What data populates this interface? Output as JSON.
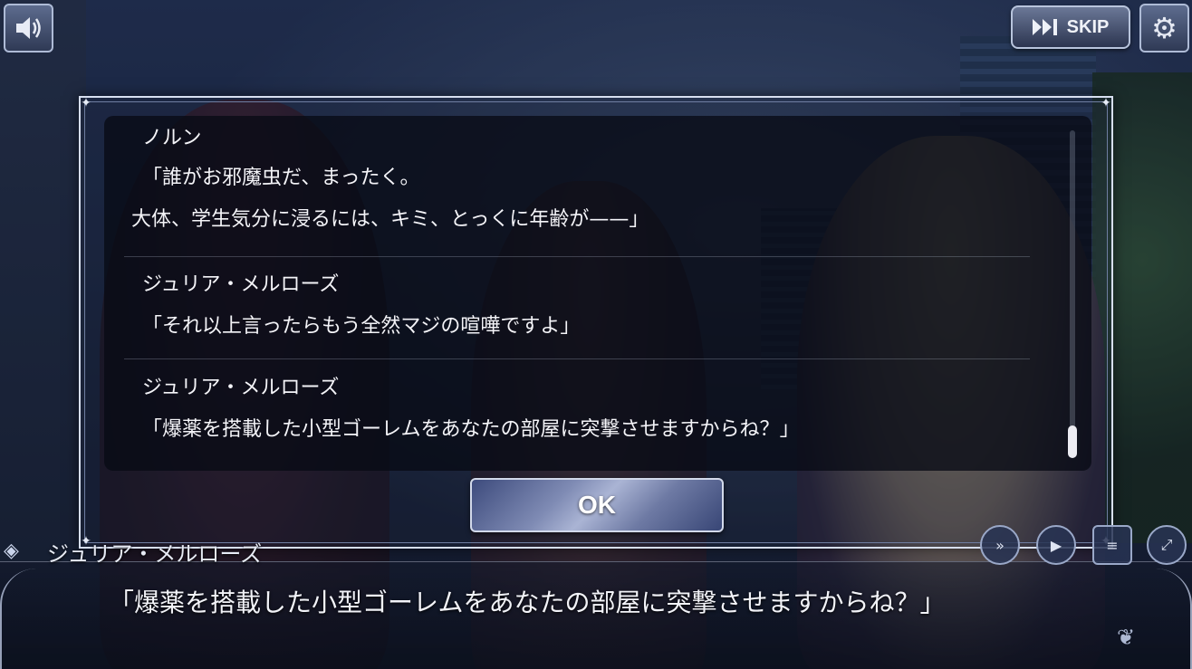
{
  "top_bar": {
    "sound_icon": "speaker-icon",
    "skip_label": "SKIP",
    "skip_icon": "fast-forward-icon",
    "settings_icon": "gear-icon"
  },
  "backlog": {
    "entries": [
      {
        "speaker": "ノルン",
        "lines": [
          "「誰がお邪魔虫だ、まったく。",
          "大体、学生気分に浸るには、キミ、とっくに年齢が——」"
        ]
      },
      {
        "speaker": "ジュリア・メルローズ",
        "lines": [
          "「それ以上言ったらもう全然マジの喧嘩ですよ」"
        ]
      },
      {
        "speaker": "ジュリア・メルローズ",
        "lines": [
          "「爆薬を搭載した小型ゴーレムをあなたの部屋に突撃させますからね？」"
        ]
      }
    ],
    "ok_label": "OK"
  },
  "message_window": {
    "speaker": "ジュリア・メルローズ",
    "text": "「爆薬を搭載した小型ゴーレムをあなたの部屋に突撃させますからね？」"
  },
  "controls": {
    "auto_icon": "auto-play-icon",
    "next_icon": "next-icon",
    "log_icon": "log-icon",
    "fullscreen_icon": "fullscreen-icon"
  }
}
